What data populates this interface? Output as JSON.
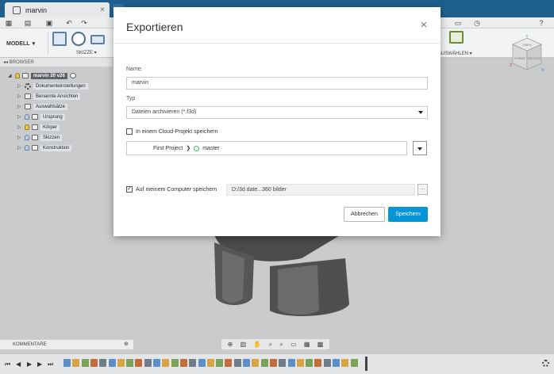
{
  "window": {
    "tab_title": "marvin",
    "tab_close": "×",
    "tab_add": "+"
  },
  "toolbar": {
    "workspace_label": "MODELL",
    "sketch_label": "SKIZZE ▾",
    "select_label": "AUSWÄHLEN ▾"
  },
  "browser": {
    "title": "BROWSER",
    "root_label": "marvin 20 v26",
    "items": [
      {
        "label": "Dokumenteinstellungen",
        "icon": "gear-icon"
      },
      {
        "label": "Benannte Ansichten",
        "icon": "folder-icon"
      },
      {
        "label": "Auswahlsätze",
        "icon": "folder-icon"
      },
      {
        "label": "Ursprung",
        "icon": "folder-icon"
      },
      {
        "label": "Körper",
        "icon": "folder-icon"
      },
      {
        "label": "Skizzen",
        "icon": "folder-icon"
      },
      {
        "label": "Konstruktion",
        "icon": "folder-icon"
      }
    ]
  },
  "viewcube": {
    "top_face": "OBEN",
    "front_face": "VORNE",
    "right_face": "RECHTS",
    "x_axis": "X",
    "y_axis": "Y",
    "z_axis": "Z"
  },
  "dialog": {
    "title": "Exportieren",
    "close_icon": "×",
    "name_label": "Name:",
    "name_value": "marvin",
    "type_label": "Typ",
    "type_value": "Dateien archivieren (*.f3d)",
    "cloud_checkbox_label": "In einem Cloud-Projekt speichern",
    "cloud_checked": false,
    "project_name": "First Project",
    "project_separator": "❯",
    "branch_name": "master",
    "local_checkbox_label": "Auf meinem Computer speichern",
    "local_checked": true,
    "local_path": "D:/3d date...360 bilder",
    "browse_label": "...",
    "cancel_label": "Abbrechen",
    "save_label": "Speichern"
  },
  "comments": {
    "label": "KOMMENTARE",
    "toggle": "⊕"
  },
  "colors": {
    "titlebar": "#1f5f8e",
    "primary_button": "#0696d7",
    "canvas": "#c9cbcd"
  }
}
